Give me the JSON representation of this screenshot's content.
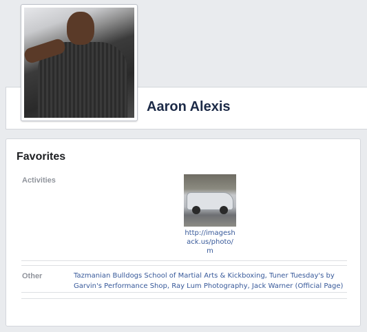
{
  "profile": {
    "name": "Aaron Alexis"
  },
  "favorites": {
    "title": "Favorites",
    "activities": {
      "label": "Activities",
      "items": [
        {
          "caption_line1": "http://imagesh",
          "caption_line2": "ack.us/photo/m"
        }
      ]
    },
    "other": {
      "label": "Other",
      "items": [
        "Tazmanian Bulldogs School of Martial Arts & Kickboxing",
        "Tuner Tuesday's by Garvin's Performance Shop",
        "Ray Lum Photography",
        "Jack Warner (Official Page)"
      ],
      "separator": ", "
    }
  },
  "colors": {
    "background": "#e9ebee",
    "link": "#365899",
    "name": "#1c2a47",
    "label": "#90949c"
  }
}
